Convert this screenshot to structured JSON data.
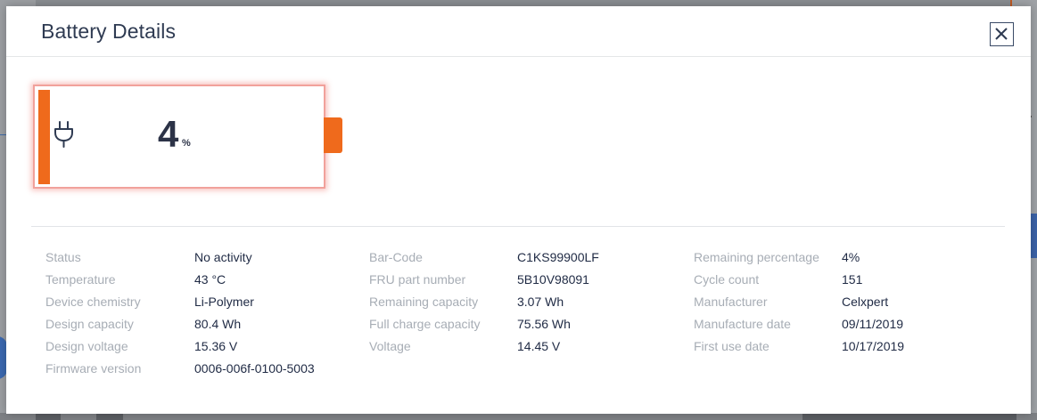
{
  "modal": {
    "title": "Battery Details"
  },
  "battery": {
    "percent": "4",
    "unit": "%",
    "level_fraction": 0.04,
    "accent_color": "#ef6a1c",
    "icon": "plug-icon"
  },
  "details": {
    "columns": [
      [
        {
          "label": "Status",
          "value": "No activity"
        },
        {
          "label": "Temperature",
          "value": "43 °C"
        },
        {
          "label": "Device chemistry",
          "value": "Li-Polymer"
        },
        {
          "label": "Design capacity",
          "value": "80.4 Wh"
        },
        {
          "label": "Design voltage",
          "value": "15.36 V"
        },
        {
          "label": "Firmware version",
          "value": "0006-006f-0100-5003"
        }
      ],
      [
        {
          "label": "Bar-Code",
          "value": "C1KS99900LF"
        },
        {
          "label": "FRU part number",
          "value": "5B10V98091"
        },
        {
          "label": "Remaining capacity",
          "value": "3.07 Wh"
        },
        {
          "label": "Full charge capacity",
          "value": "75.56 Wh"
        },
        {
          "label": "Voltage",
          "value": "14.45 V"
        }
      ],
      [
        {
          "label": "Remaining percentage",
          "value": "4%"
        },
        {
          "label": "Cycle count",
          "value": "151"
        },
        {
          "label": "Manufacturer",
          "value": "Celxpert"
        },
        {
          "label": "Manufacture date",
          "value": "09/11/2019"
        },
        {
          "label": "First use date",
          "value": "10/17/2019"
        }
      ]
    ]
  }
}
